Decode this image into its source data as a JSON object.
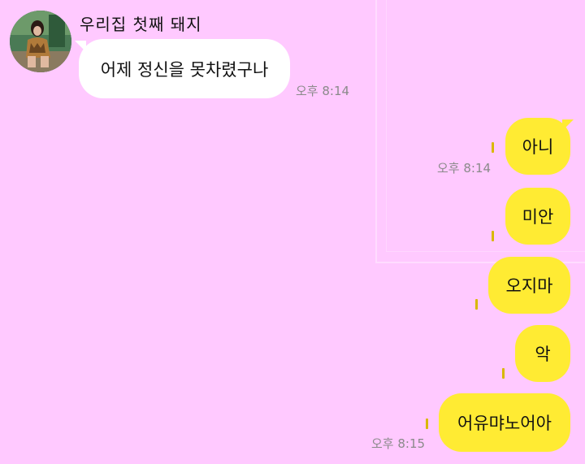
{
  "chat": {
    "incoming": {
      "sender_name": "우리집 첫째 돼지",
      "message": "어제 정신을 못차렸구나",
      "time": "오후 8:14",
      "avatar_icon": "profile-photo"
    },
    "outgoing": [
      {
        "text": "아니",
        "time": "오후 8:14"
      },
      {
        "text": "미안",
        "time": ""
      },
      {
        "text": "오지마",
        "time": ""
      },
      {
        "text": "악",
        "time": ""
      },
      {
        "text": "어유먀노어아",
        "time": "오후 8:15"
      }
    ]
  },
  "colors": {
    "background": "#ffc9ff",
    "outgoing_bubble": "#ffeb33",
    "incoming_bubble": "#ffffff",
    "timestamp": "#8a8a8a"
  }
}
